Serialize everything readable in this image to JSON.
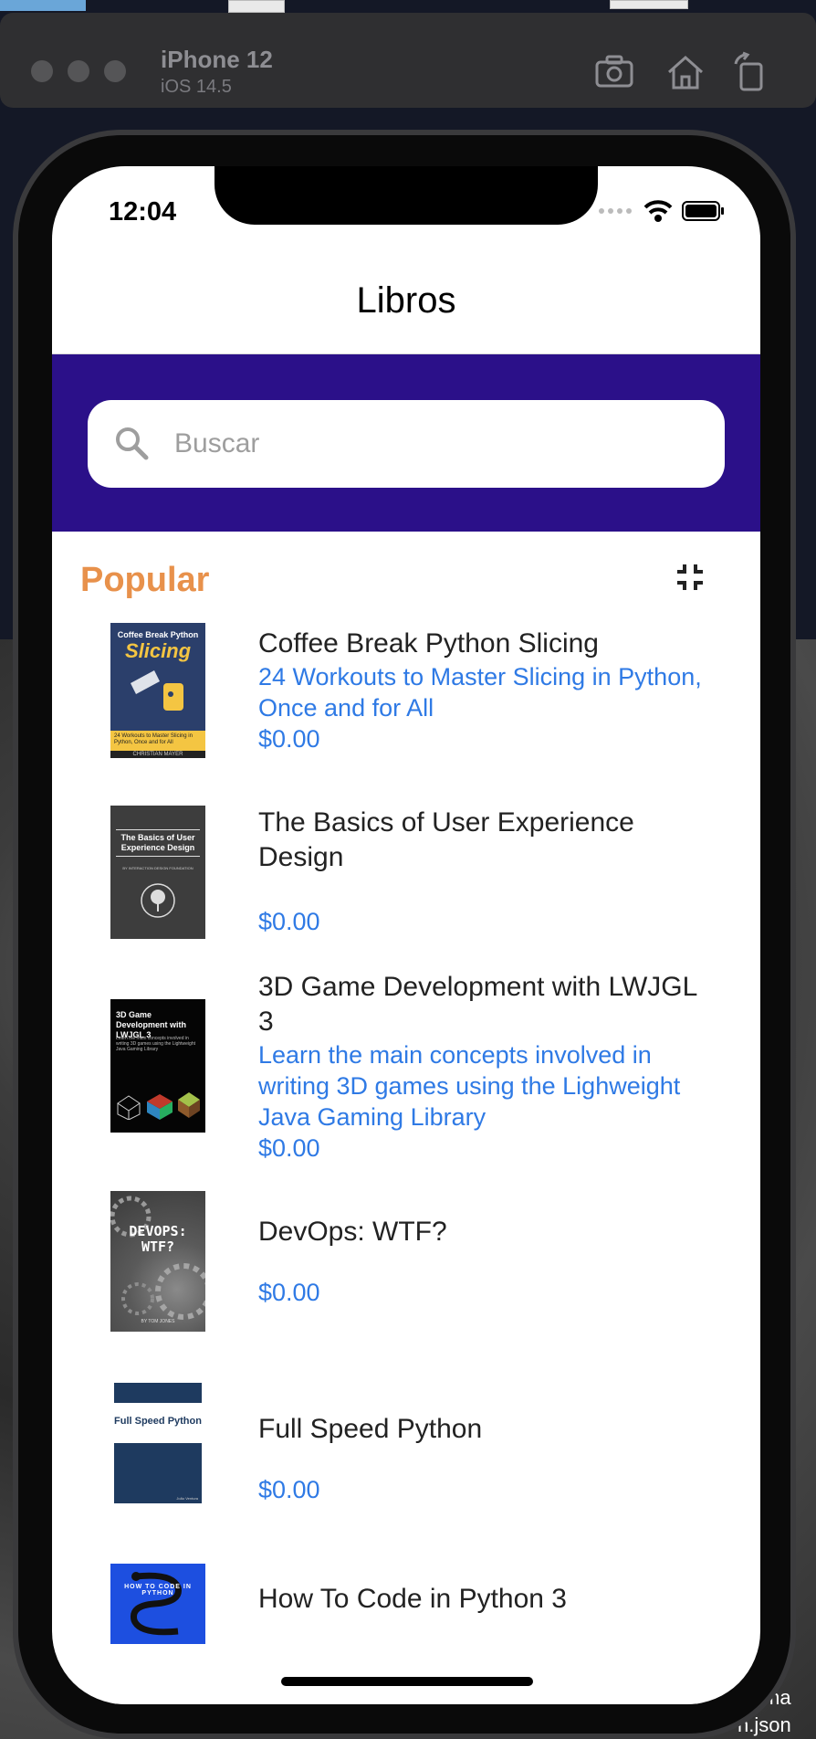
{
  "simulator": {
    "device": "iPhone 12",
    "os": "iOS 14.5"
  },
  "status_bar": {
    "time": "12:04"
  },
  "nav": {
    "title": "Libros"
  },
  "search": {
    "placeholder": "Buscar"
  },
  "section": {
    "title": "Popular"
  },
  "books": [
    {
      "title": "Coffee Break Python Slicing",
      "subtitle": "24 Workouts to Master Slicing in Python, Once and for All",
      "price": "$0.00",
      "cover": {
        "bg": "#2b3f6b",
        "accent": "#f4c542",
        "text": "Coffee Break Python",
        "big": "Slicing",
        "footer": "24 Workouts to Master Slicing in Python, Once and for All",
        "author": "CHRISTIAN MAYER"
      }
    },
    {
      "title": "The Basics of User Experience Design",
      "subtitle": "",
      "price": "$0.00",
      "cover": {
        "bg": "#3d3d3d",
        "text": "The Basics of User Experience Design",
        "sub": "BY INTERACTION DESIGN FOUNDATION"
      }
    },
    {
      "title": "3D Game Development with LWJGL 3",
      "subtitle": "Learn the main concepts involved in writing 3D games using the Lighweight Java Gaming Library",
      "price": "$0.00",
      "cover": {
        "bg": "#050505",
        "text": "3D Game Development with LWJGL 3",
        "sub": "Learn the main concepts involved in writing 3D games using the Lightweight Java Gaming Library"
      }
    },
    {
      "title": "DevOps: WTF?",
      "subtitle": "",
      "price": "$0.00",
      "cover": {
        "bg": "#6b6b6b",
        "text": "DEVOPS: WTF?",
        "author": "BY TOM JONES"
      }
    },
    {
      "title": "Full Speed Python",
      "subtitle": "",
      "price": "$0.00",
      "cover": {
        "bg": "#1e3a5f",
        "text": "Full Speed Python",
        "author": "João Ventura"
      }
    },
    {
      "title": "How To Code in Python 3",
      "subtitle": "",
      "price": "",
      "cover": {
        "bg": "#1d4fe0",
        "text": "HOW TO CODE IN PYTHON"
      }
    }
  ],
  "desktop_labels": [
    "ma",
    "n.json"
  ],
  "colors": {
    "search_band": "#2b1089",
    "accent": "#e8914b",
    "link": "#2f7ae5"
  }
}
